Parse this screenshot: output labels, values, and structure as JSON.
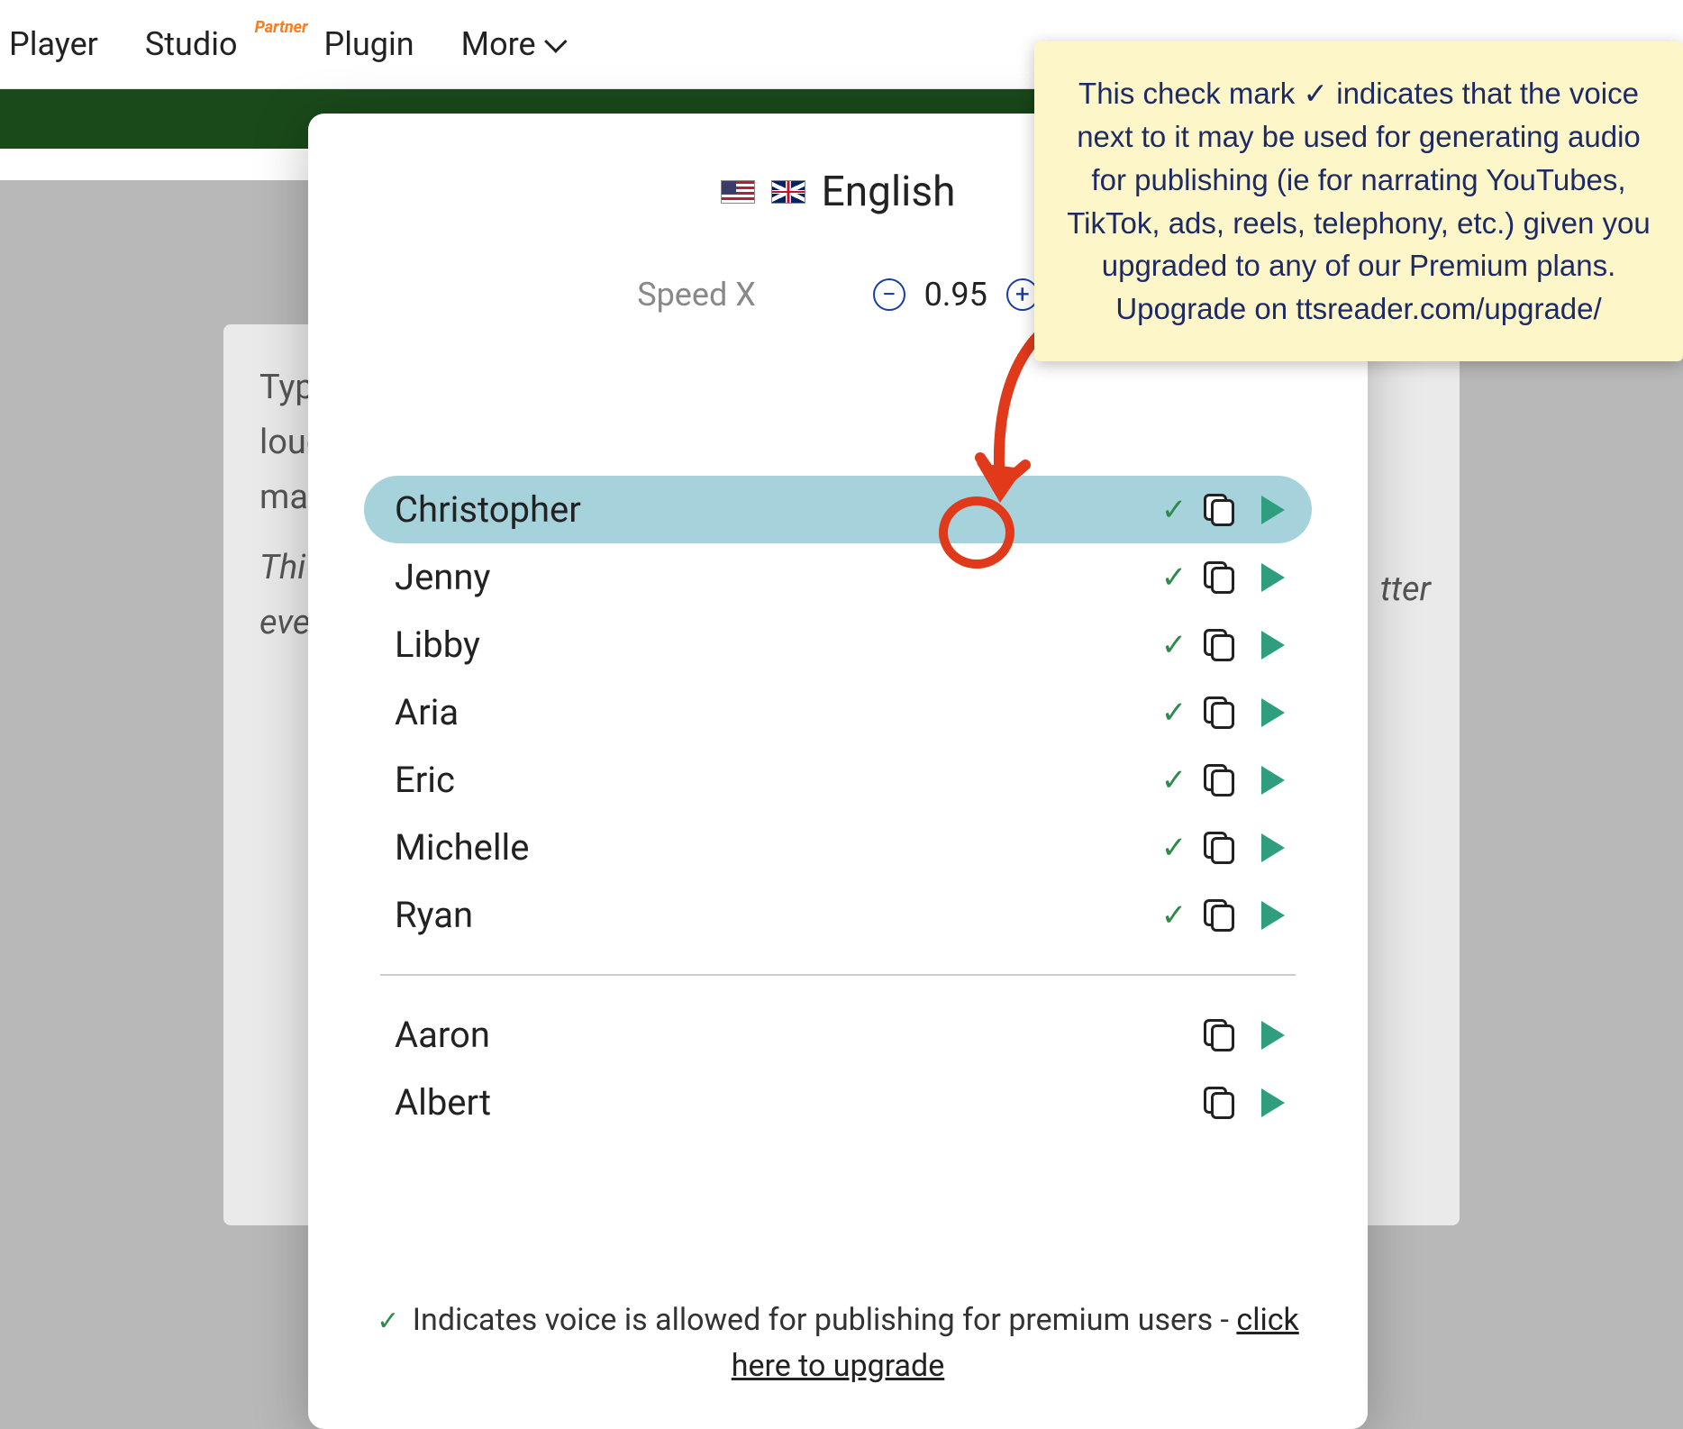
{
  "nav": {
    "player": "Player",
    "studio": "Studio",
    "partner_badge": "Partner",
    "plugin": "Plugin",
    "more": "More"
  },
  "bg": {
    "line1": "Typ",
    "line2": "louc",
    "line3": "may",
    "line4": "Thi",
    "line5": "eve",
    "right": "tter"
  },
  "modal": {
    "language": "English",
    "speed_label": "Speed X",
    "speed_value": "0.95",
    "voices_premium": [
      {
        "name": "Christopher",
        "allowed": true,
        "selected": true
      },
      {
        "name": "Jenny",
        "allowed": true,
        "selected": false
      },
      {
        "name": "Libby",
        "allowed": true,
        "selected": false
      },
      {
        "name": "Aria",
        "allowed": true,
        "selected": false
      },
      {
        "name": "Eric",
        "allowed": true,
        "selected": false
      },
      {
        "name": "Michelle",
        "allowed": true,
        "selected": false
      },
      {
        "name": "Ryan",
        "allowed": true,
        "selected": false
      }
    ],
    "voices_other": [
      {
        "name": "Aaron",
        "allowed": false
      },
      {
        "name": "Albert",
        "allowed": false
      }
    ],
    "footer_prefix": "Indicates voice is allowed for publishing for premium users - ",
    "footer_link": "click here to upgrade"
  },
  "annotation": {
    "text": "This check mark ✓ indicates that the voice next to it may be used for generating audio for publishing (ie for narrating YouTubes, TikTok, ads, reels, telephony, etc.) given you upgraded to any of our Premium plans. Upograde on ttsreader.com/upgrade/"
  }
}
